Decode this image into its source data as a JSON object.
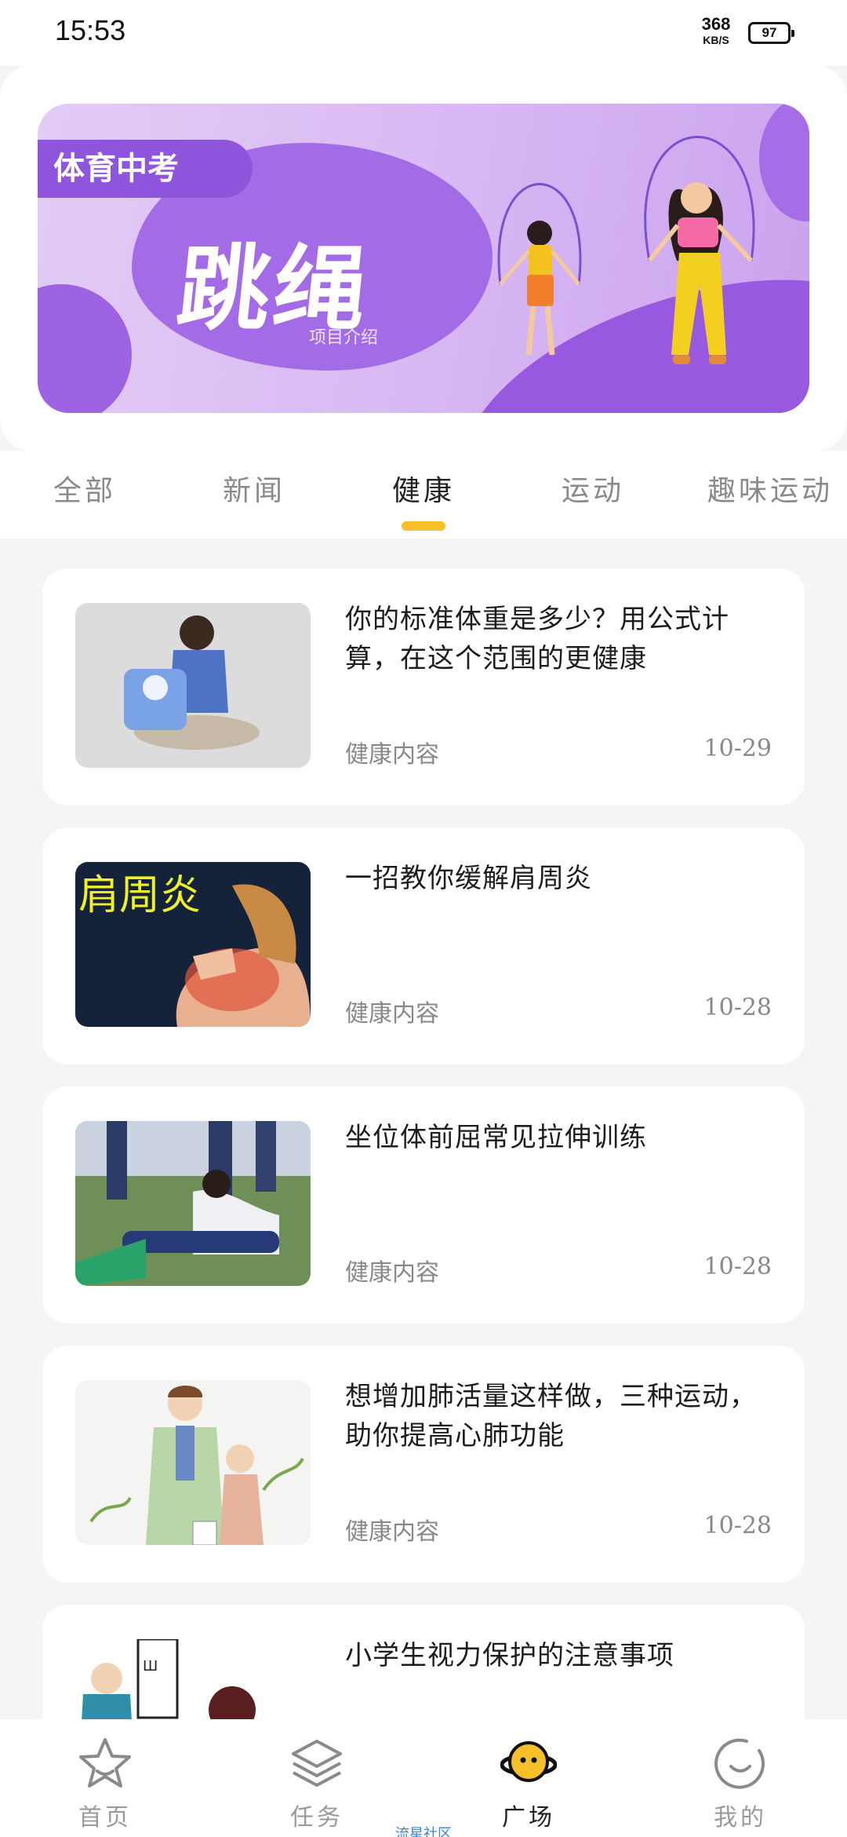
{
  "status_bar": {
    "time": "15:53",
    "net_speed_value": "368",
    "net_speed_unit": "KB/S",
    "battery": "97"
  },
  "banner": {
    "tag": "体育中考",
    "title": "跳绳",
    "subtitle": "项目介绍",
    "colors": {
      "background": "#d8b7f3",
      "accent": "#8f55dd"
    }
  },
  "tabs": [
    {
      "label": "全部"
    },
    {
      "label": "新闻"
    },
    {
      "label": "健康"
    },
    {
      "label": "运动"
    },
    {
      "label": "趣味运动"
    }
  ],
  "active_tab": "健康",
  "accent_color": "#f6c02a",
  "articles": [
    {
      "title": "你的标准体重是多少？用公式计算，在这个范围的更健康",
      "category": "健康内容",
      "date": "10-29",
      "thumb_icon": "weight-scale-photo"
    },
    {
      "title": "一招教你缓解肩周炎",
      "category": "健康内容",
      "date": "10-28",
      "thumb_icon": "shoulder-pain-photo",
      "thumb_text": "肩周炎"
    },
    {
      "title": "坐位体前屈常见拉伸训练",
      "category": "健康内容",
      "date": "10-28",
      "thumb_icon": "sit-and-reach-photo"
    },
    {
      "title": "想增加肺活量这样做，三种运动，助你提高心肺功能",
      "category": "健康内容",
      "date": "10-28",
      "thumb_icon": "lung-capacity-illustration"
    },
    {
      "title": "小学生视力保护的注意事项",
      "category": "",
      "date": "",
      "thumb_icon": "eye-chart-illustration"
    }
  ],
  "bottom_nav": {
    "items": [
      {
        "label": "首页",
        "icon": "star-icon"
      },
      {
        "label": "任务",
        "icon": "layers-icon"
      },
      {
        "label": "广场",
        "icon": "planet-icon"
      },
      {
        "label": "我的",
        "icon": "smile-icon"
      }
    ],
    "hint": "流星社区"
  }
}
